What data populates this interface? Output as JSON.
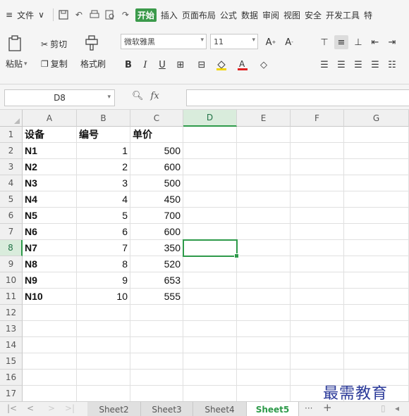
{
  "menubar": {
    "hamburger": "≡",
    "file_label": "文件",
    "tabs": [
      "开始",
      "插入",
      "页面布局",
      "公式",
      "数据",
      "审阅",
      "视图",
      "安全",
      "开发工具",
      "特"
    ],
    "active_tab": "开始"
  },
  "ribbon": {
    "paste_label": "粘贴",
    "cut_label": "剪切",
    "copy_label": "复制",
    "format_painter_label": "格式刷",
    "font_name": "微软雅黑",
    "font_size": "11"
  },
  "formula_bar": {
    "name_box": "D8",
    "fx_label": "fx",
    "formula": ""
  },
  "sheet": {
    "columns": [
      "A",
      "B",
      "C",
      "D",
      "E",
      "F",
      "G"
    ],
    "active_column": "D",
    "row_numbers": [
      "1",
      "2",
      "3",
      "4",
      "5",
      "6",
      "7",
      "8",
      "9",
      "10",
      "11",
      "12",
      "13",
      "14",
      "15",
      "16",
      "17"
    ],
    "active_row": "8",
    "header_row": [
      "设备",
      "编号",
      "单价"
    ],
    "rows": [
      {
        "device": "N1",
        "id": "1",
        "price": "500"
      },
      {
        "device": "N2",
        "id": "2",
        "price": "600"
      },
      {
        "device": "N3",
        "id": "3",
        "price": "500"
      },
      {
        "device": "N4",
        "id": "4",
        "price": "450"
      },
      {
        "device": "N5",
        "id": "5",
        "price": "700"
      },
      {
        "device": "N6",
        "id": "6",
        "price": "600"
      },
      {
        "device": "N7",
        "id": "7",
        "price": "350"
      },
      {
        "device": "N8",
        "id": "8",
        "price": "520"
      },
      {
        "device": "N9",
        "id": "9",
        "price": "653"
      },
      {
        "device": "N10",
        "id": "10",
        "price": "555"
      }
    ]
  },
  "tabs": {
    "sheets": [
      "Sheet2",
      "Sheet3",
      "Sheet4",
      "Sheet5"
    ],
    "active_sheet": "Sheet5",
    "more": "···",
    "add": "+"
  },
  "watermark": "最需教育",
  "colors": {
    "accent_green": "#2e9a4a",
    "watermark_blue": "#2b3a99"
  }
}
